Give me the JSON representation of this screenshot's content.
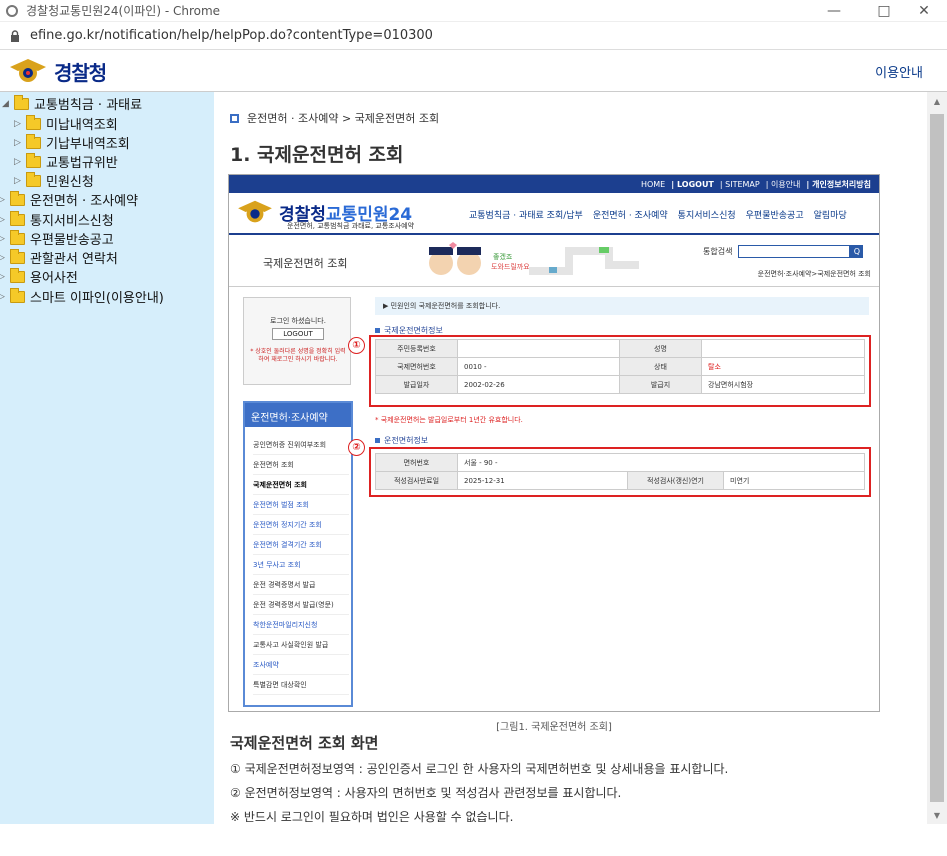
{
  "window": {
    "title": "경찰청교통민원24(이파인) - Chrome",
    "url": "efine.go.kr/notification/help/helpPop.do?contentType=010300"
  },
  "header": {
    "logo_text": "경찰청",
    "help_link": "이용안내"
  },
  "tree": {
    "items": [
      {
        "label": "교통범칙금 · 과태료",
        "level": 0,
        "expanded": true
      },
      {
        "label": "미납내역조회",
        "level": 1
      },
      {
        "label": "기납부내역조회",
        "level": 1
      },
      {
        "label": "교통법규위반",
        "level": 1
      },
      {
        "label": "민원신청",
        "level": 1
      },
      {
        "label": "운전면허 · 조사예약",
        "level": 0
      },
      {
        "label": "통지서비스신청",
        "level": 0
      },
      {
        "label": "우편물반송공고",
        "level": 0
      },
      {
        "label": "관할관서 연락처",
        "level": 0
      },
      {
        "label": "용어사전",
        "level": 0
      },
      {
        "label": "스마트 이파인(이용안내)",
        "level": 0
      }
    ]
  },
  "main": {
    "breadcrumb": "운전면허 · 조사예약 > 국제운전면허 조회",
    "title": "1. 국제운전면허 조회",
    "shot": {
      "topnav": [
        "HOME",
        "| LOGOUT",
        "| SITEMAP",
        "| 이용안내",
        "| 개인정보처리방침"
      ],
      "site_logo": "경찰청",
      "site_logo_b": "교통민원24",
      "site_sub": "운전면허, 교통범칙금 과태료, 교통조사예약",
      "site_menu": [
        "교통범칙금 · 과태료 조회/납부",
        "운전면허 · 조사예약",
        "통지서비스신청",
        "우편물반송공고",
        "알림마당"
      ],
      "banner_title": "국제운전면허 조회",
      "search_label": "통합검색",
      "search_btn": "Q",
      "crumb": "운전면허·조사예약>국제운전면허 조회",
      "login_text": "로그인 하셨습니다.",
      "logout_btn": "LOGOUT",
      "login_warn": "* 상호인 둘러다른 성명을 정확히 입력하여 재로그인 하시기 바랍니다.",
      "left_menu_title": "운전면허·조사예약",
      "left_menu": [
        "공인면허증 진위여부조회",
        "운전면허 조회",
        "국제운전면허 조회",
        "운전면허 벌점 조회",
        "운전면허 정지기간 조회",
        "운전면허 결격기간 조회",
        "3년 무사고 조회",
        "운전 경력증명서 발급",
        "운전 경력증명서 발급(영문)",
        "착한운전마일리지신청",
        "교통사고 사실확인원 발급",
        "조사예약",
        "특별감면 대상확인"
      ],
      "info_bar": "▶ 민원인의 국제운전면허를 조회합니다.",
      "sect1": "국제운전면허정보",
      "t1": {
        "r1": {
          "k1": "주민등록번호",
          "v1": "",
          "k2": "성명",
          "v2": ""
        },
        "r2": {
          "k1": "국제면허번호",
          "v1": "0010 -",
          "k2": "상태",
          "v2": "탈소"
        },
        "r3": {
          "k1": "발급일자",
          "v1": "2002-02-26",
          "k2": "발급지",
          "v2": "강남면허시험장"
        }
      },
      "note": "* 국제운전면허는 발급일로부터 1년간 유효합니다.",
      "sect2": "운전면허정보",
      "t2": {
        "r1": {
          "k1": "면허번호",
          "v1": "서울 - 90 -"
        },
        "r2": {
          "k1": "적성검사만료일",
          "v1": "2025-12-31",
          "k2": "적성검사(갱신)연기",
          "v2": "미연기"
        }
      },
      "marker1": "①",
      "marker2": "②"
    },
    "caption": "[그림1. 국제운전면허 조회]",
    "section_title": "국제운전면허 조회 화면",
    "desc1": "① 국제운전면허정보영역 : 공인인증서 로그인 한 사용자의 국제면허번호 및 상세내용을 표시합니다.",
    "desc2": "② 운전면허정보영역 : 사용자의 면허번호 및 적성검사 관련정보를 표시합니다.",
    "desc3": "※ 반드시 로그인이 필요하며 법인은 사용할 수 없습니다."
  }
}
